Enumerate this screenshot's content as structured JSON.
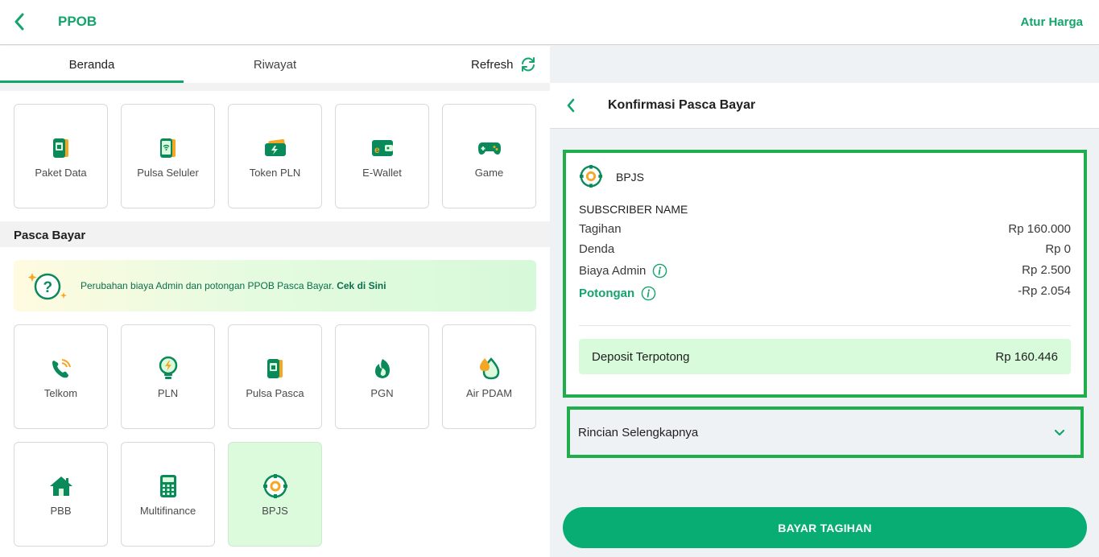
{
  "header": {
    "title": "PPOB",
    "action_label": "Atur Harga"
  },
  "tabs": [
    {
      "label": "Beranda",
      "active": true
    },
    {
      "label": "Riwayat",
      "active": false
    }
  ],
  "refresh_label": "Refresh",
  "prabayar": {
    "items": [
      {
        "label": "Paket Data",
        "icon": "phone-card-icon"
      },
      {
        "label": "Pulsa Seluler",
        "icon": "phone-signal-icon"
      },
      {
        "label": "Token PLN",
        "icon": "token-bolt-icon"
      },
      {
        "label": "E-Wallet",
        "icon": "wallet-icon"
      },
      {
        "label": "Game",
        "icon": "gamepad-icon"
      }
    ]
  },
  "pascabayar": {
    "title": "Pasca Bayar",
    "banner_text": "Perubahan biaya Admin dan potongan PPOB Pasca Bayar. ",
    "banner_link": "Cek di Sini",
    "items": [
      {
        "label": "Telkom",
        "icon": "telephone-icon"
      },
      {
        "label": "PLN",
        "icon": "lightbulb-icon"
      },
      {
        "label": "Pulsa Pasca",
        "icon": "phone-card-icon"
      },
      {
        "label": "PGN",
        "icon": "flame-icon"
      },
      {
        "label": "Air PDAM",
        "icon": "water-drop-icon"
      },
      {
        "label": "PBB",
        "icon": "house-icon"
      },
      {
        "label": "Multifinance",
        "icon": "calculator-icon"
      },
      {
        "label": "BPJS",
        "icon": "bpjs-logo-icon",
        "selected": true
      }
    ]
  },
  "confirm": {
    "title": "Konfirmasi Pasca Bayar",
    "provider": "BPJS",
    "subscriber": "SUBSCRIBER NAME",
    "rows": [
      {
        "label": "Tagihan",
        "value": "Rp 160.000"
      },
      {
        "label": "Denda",
        "value": "Rp 0"
      },
      {
        "label": "Biaya Admin",
        "value": "Rp 2.500"
      },
      {
        "label": "Potongan",
        "value": "-Rp 2.054"
      }
    ],
    "deposit_label": "Deposit Terpotong",
    "deposit_value": "Rp 160.446",
    "details_label": "Rincian Selengkapnya",
    "pay_label": "BAYAR TAGIHAN"
  },
  "colors": {
    "brand": "#14a46c",
    "button": "#07ad73",
    "highlight": "#1fae4b",
    "selected_bg": "#dbfbdc"
  }
}
